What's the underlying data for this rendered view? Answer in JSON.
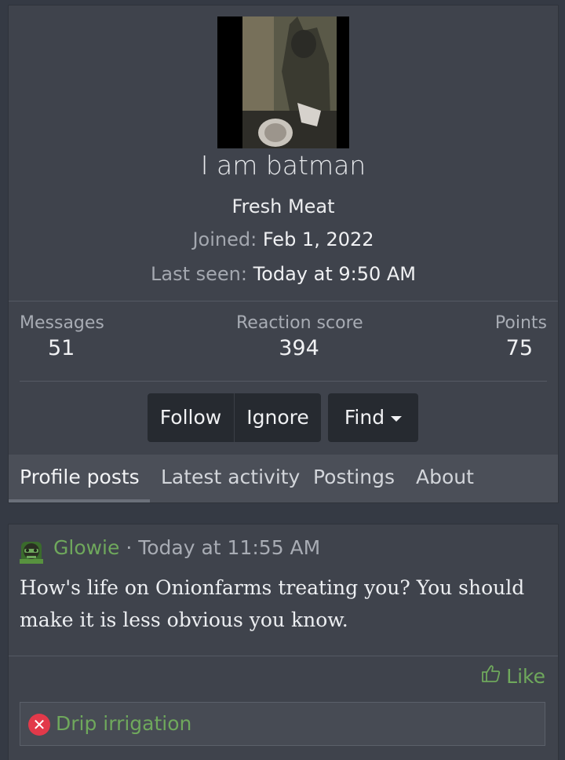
{
  "profile": {
    "username": "I am batman",
    "user_title": "Fresh Meat",
    "joined_label": "Joined:",
    "joined_value": "Feb 1, 2022",
    "last_seen_label": "Last seen:",
    "last_seen_value": "Today at 9:50 AM"
  },
  "stats": [
    {
      "label": "Messages",
      "value": "51"
    },
    {
      "label": "Reaction score",
      "value": "394"
    },
    {
      "label": "Points",
      "value": "75"
    }
  ],
  "actions": {
    "follow": "Follow",
    "ignore": "Ignore",
    "find": "Find"
  },
  "tabs": [
    {
      "label": "Profile posts",
      "active": true
    },
    {
      "label": "Latest activity",
      "active": false
    },
    {
      "label": "Postings",
      "active": false
    },
    {
      "label": "About",
      "active": false
    }
  ],
  "post": {
    "author": "Glowie",
    "separator": " · ",
    "time": "Today at 11:55 AM",
    "body": "How's life on Onionfarms treating you? You should make it is less obvious you know.",
    "like_label": "Like",
    "reaction_label": "Drip irrigation"
  },
  "colors": {
    "page_bg": "#353a44",
    "card_bg": "#3f434c",
    "accent_green": "#6fa85c",
    "reaction_red": "#e2394a"
  },
  "icons": {
    "like": "thumbs-up-icon",
    "reaction": "x-circle-icon",
    "dropdown": "caret-down-icon"
  }
}
